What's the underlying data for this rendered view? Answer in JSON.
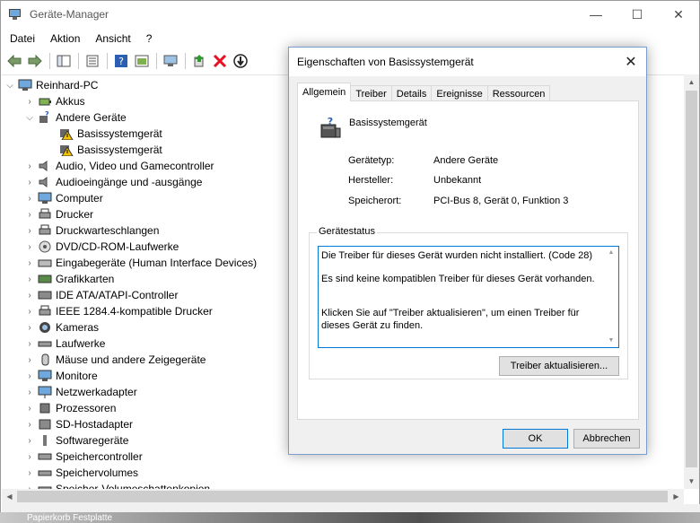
{
  "main_window": {
    "title": "Geräte-Manager",
    "controls": {
      "minimize": "—",
      "maximize": "☐",
      "close": "✕"
    }
  },
  "menu": [
    "Datei",
    "Aktion",
    "Ansicht",
    "?"
  ],
  "toolbar_icons": [
    "back-icon",
    "forward-icon",
    "show-hide-tree-icon",
    "properties-icon",
    "help-icon",
    "view-icon",
    "scan-hardware-icon",
    "update-driver-icon",
    "uninstall-icon",
    "disable-device-icon"
  ],
  "tree": {
    "root": "Reinhard-PC",
    "items": [
      {
        "label": "Akkus",
        "icon": "battery-icon",
        "expanded": false
      },
      {
        "label": "Andere Geräte",
        "icon": "unknown-device-icon",
        "expanded": true,
        "children": [
          "Basissystemgerät",
          "Basissystemgerät"
        ]
      },
      {
        "label": "Audio, Video und Gamecontroller",
        "icon": "speaker-icon",
        "expanded": false
      },
      {
        "label": "Audioeingänge und -ausgänge",
        "icon": "speaker-icon",
        "expanded": false
      },
      {
        "label": "Computer",
        "icon": "computer-icon",
        "expanded": false
      },
      {
        "label": "Drucker",
        "icon": "printer-icon",
        "expanded": false
      },
      {
        "label": "Druckwarteschlangen",
        "icon": "print-queue-icon",
        "expanded": false
      },
      {
        "label": "DVD/CD-ROM-Laufwerke",
        "icon": "disc-drive-icon",
        "expanded": false
      },
      {
        "label": "Eingabegeräte (Human Interface Devices)",
        "icon": "hid-icon",
        "expanded": false
      },
      {
        "label": "Grafikkarten",
        "icon": "display-adapter-icon",
        "expanded": false
      },
      {
        "label": "IDE ATA/ATAPI-Controller",
        "icon": "ide-controller-icon",
        "expanded": false
      },
      {
        "label": "IEEE 1284.4-kompatible Drucker",
        "icon": "printer-icon",
        "expanded": false
      },
      {
        "label": "Kameras",
        "icon": "camera-icon",
        "expanded": false
      },
      {
        "label": "Laufwerke",
        "icon": "disk-drive-icon",
        "expanded": false
      },
      {
        "label": "Mäuse und andere Zeigegeräte",
        "icon": "mouse-icon",
        "expanded": false
      },
      {
        "label": "Monitore",
        "icon": "monitor-icon",
        "expanded": false
      },
      {
        "label": "Netzwerkadapter",
        "icon": "network-adapter-icon",
        "expanded": false
      },
      {
        "label": "Prozessoren",
        "icon": "processor-icon",
        "expanded": false
      },
      {
        "label": "SD-Hostadapter",
        "icon": "sd-host-icon",
        "expanded": false
      },
      {
        "label": "Softwaregeräte",
        "icon": "software-device-icon",
        "expanded": false
      },
      {
        "label": "Speichercontroller",
        "icon": "storage-controller-icon",
        "expanded": false
      },
      {
        "label": "Speichervolumes",
        "icon": "storage-volume-icon",
        "expanded": false
      },
      {
        "label": "Speicher-Volumeschattenkopien",
        "icon": "shadow-copy-icon",
        "expanded": false
      }
    ]
  },
  "dialog": {
    "title": "Eigenschaften von Basissystemgerät",
    "close": "✕",
    "tabs": [
      "Allgemein",
      "Treiber",
      "Details",
      "Ereignisse",
      "Ressourcen"
    ],
    "active_tab": "Allgemein",
    "device_name": "Basissystemgerät",
    "properties": [
      {
        "label": "Gerätetyp:",
        "value": "Andere Geräte"
      },
      {
        "label": "Hersteller:",
        "value": "Unbekannt"
      },
      {
        "label": "Speicherort:",
        "value": "PCI-Bus 8, Gerät 0, Funktion 3"
      }
    ],
    "status_group_label": "Gerätestatus",
    "status_lines": [
      "Die Treiber für dieses Gerät wurden nicht installiert. (Code 28)",
      "Es sind keine kompatiblen Treiber für dieses Gerät vorhanden.",
      "Klicken Sie auf \"Treiber aktualisieren\", um einen Treiber für dieses Gerät zu finden."
    ],
    "update_driver_button": "Treiber aktualisieren...",
    "ok_button": "OK",
    "cancel_button": "Abbrechen"
  },
  "taskbar_text": "Papierkorb  Festplatte",
  "colors": {
    "accent": "#0078d7",
    "warning": "#f2c200",
    "error": "#e81123"
  }
}
